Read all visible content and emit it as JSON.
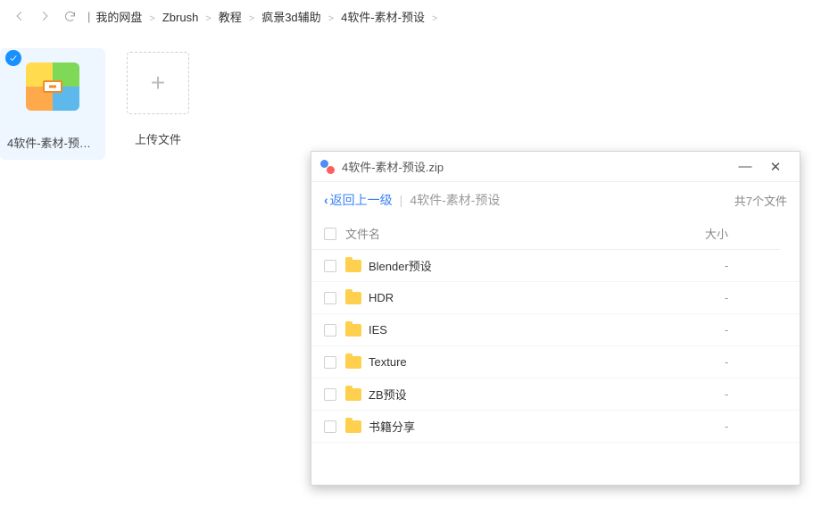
{
  "nav": {
    "breadcrumbs": [
      "我的网盘",
      "Zbrush",
      "教程",
      "疯景3d辅助",
      "4软件-素材-预设"
    ]
  },
  "tiles": {
    "archive_label": "4软件-素材-预设....",
    "upload_label": "上传文件"
  },
  "viewer": {
    "title": "4软件-素材-预设.zip",
    "back_label": "返回上一级",
    "path_label": "4软件-素材-预设",
    "count_label": "共7个文件",
    "columns": {
      "name": "文件名",
      "size": "大小"
    },
    "items": [
      {
        "name": "Blender预设",
        "size": "-"
      },
      {
        "name": "HDR",
        "size": "-"
      },
      {
        "name": "IES",
        "size": "-"
      },
      {
        "name": "Texture",
        "size": "-"
      },
      {
        "name": "ZB预设",
        "size": "-"
      },
      {
        "name": "书籍分享",
        "size": "-"
      }
    ],
    "min_glyph": "—",
    "close_glyph": "✕"
  }
}
